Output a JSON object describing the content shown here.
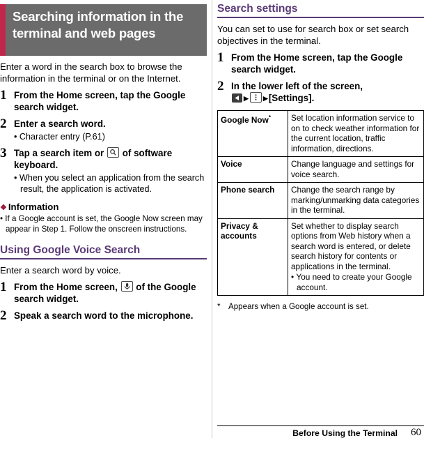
{
  "banner": {
    "title": "Searching information in the terminal and web pages"
  },
  "left": {
    "intro": "Enter a word in the search box to browse the information in the terminal or on the Internet.",
    "steps": [
      {
        "num": "1",
        "text": "From the Home screen, tap the Google search widget."
      },
      {
        "num": "2",
        "text": "Enter a search word.",
        "sub": [
          "Character entry (P.61)"
        ]
      },
      {
        "num": "3",
        "text_a": "Tap a search item or",
        "text_b": "of software keyboard.",
        "sub": [
          "When you select an application from the search result, the application is activated."
        ]
      }
    ],
    "info_heading": "Information",
    "info_items": [
      "If a Google account is set, the Google Now screen may appear in Step 1. Follow the onscreen instructions."
    ],
    "voice_heading": "Using Google Voice Search",
    "voice_intro": "Enter a search word by voice.",
    "voice_steps": [
      {
        "num": "1",
        "text_a": "From the Home screen,",
        "text_b": "of the Google search widget."
      },
      {
        "num": "2",
        "text": "Speak a search word to the microphone."
      }
    ]
  },
  "right": {
    "heading": "Search settings",
    "intro": "You can set to use for search box or set search objectives in the terminal.",
    "steps": [
      {
        "num": "1",
        "text": "From the Home screen, tap the Google search widget."
      },
      {
        "num": "2",
        "text_a": "In the lower left of the screen,",
        "text_b": "[Settings]."
      }
    ],
    "table": {
      "rows": [
        {
          "term": "Google Now",
          "term_sup": "*",
          "desc": "Set location information service to on to check weather information for the current location, traffic information, directions."
        },
        {
          "term": "Voice",
          "desc": "Change language and settings for voice search."
        },
        {
          "term": "Phone search",
          "desc": "Change the search range by marking/unmarking data categories in the terminal."
        },
        {
          "term": "Privacy & accounts",
          "desc": "Set whether to display search options from Web history when a search word is entered, or delete search history for contents or applications in the terminal.",
          "sub": [
            "You need to create your Google account."
          ]
        }
      ]
    },
    "footnote_marker": "*",
    "footnote_text": "Appears when a Google account is set."
  },
  "footer": {
    "label": "Before Using the Terminal",
    "page": "60"
  }
}
